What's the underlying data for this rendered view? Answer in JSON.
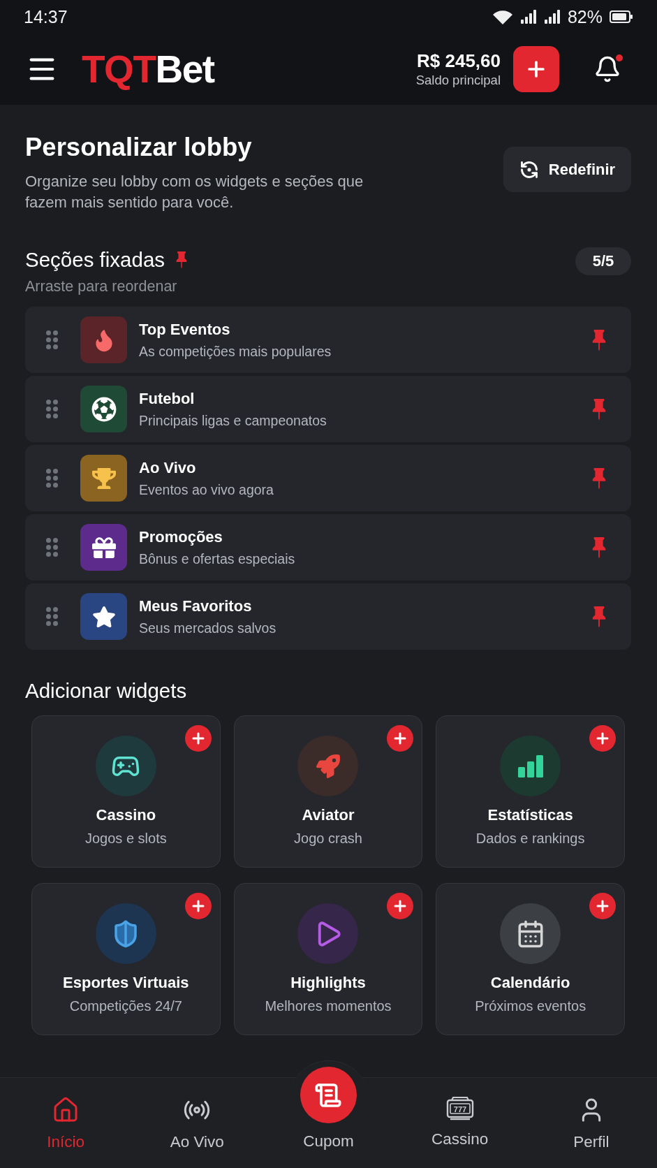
{
  "status_bar": {
    "time": "14:37",
    "battery": "82%"
  },
  "header": {
    "logo": [
      {
        "text": "TQT",
        "accent": true
      },
      {
        "text": "Bet",
        "accent": false
      }
    ],
    "balance": "R$ 245,60",
    "balance_label": "Saldo principal",
    "notifications_unread": true
  },
  "intro": {
    "title": "Personalizar lobby",
    "description": "Organize seu lobby com os widgets e seções que fazem mais sentido para você.",
    "reset_button": "Redefinir"
  },
  "pinned_sections": {
    "title": "Seções fixadas",
    "subtitle": "Arraste para reordenar",
    "count": "5/5",
    "items": [
      {
        "kind": "fire",
        "title": "Top Eventos",
        "subtitle": "As competições mais populares",
        "color": "#5b2429",
        "pinned": true
      },
      {
        "kind": "football",
        "title": "Futebol",
        "subtitle": "Principais ligas e campeonatos",
        "color": "#1f4a35",
        "pinned": true
      },
      {
        "kind": "trophy",
        "title": "Ao Vivo",
        "subtitle": "Eventos ao vivo agora",
        "color": "#8b6421",
        "pinned": true
      },
      {
        "kind": "gift",
        "title": "Promoções",
        "subtitle": "Bônus e ofertas especiais",
        "color": "#5c2b8c",
        "pinned": true
      },
      {
        "kind": "star",
        "title": "Meus Favoritos",
        "subtitle": "Seus mercados salvos",
        "color": "#294682",
        "pinned": true
      }
    ]
  },
  "widgets": {
    "title": "Adicionar widgets",
    "items": [
      {
        "kind": "gamepad",
        "name": "Cassino",
        "subtitle": "Jogos e slots",
        "color": "#1f3a3d"
      },
      {
        "kind": "rocket",
        "name": "Aviator",
        "subtitle": "Jogo crash",
        "color": "#3b2c29"
      },
      {
        "kind": "stats",
        "name": "Estatísticas",
        "subtitle": "Dados e rankings",
        "color": "#1c3a30"
      },
      {
        "kind": "shield",
        "name": "Esportes Virtuais",
        "subtitle": "Competições 24/7",
        "color": "#1d3550"
      },
      {
        "kind": "play",
        "name": "Highlights",
        "subtitle": "Melhores momentos",
        "color": "#35264a"
      },
      {
        "kind": "calendar",
        "name": "Calendário",
        "subtitle": "Próximos eventos",
        "color": "#3c3f44"
      }
    ]
  },
  "bottom_nav": [
    {
      "kind": "home",
      "label": "Início",
      "selected": true
    },
    {
      "kind": "broadcast",
      "label": "Ao Vivo",
      "selected": false
    },
    {
      "kind": "coupon",
      "label": "Cupom",
      "selected": false
    },
    {
      "kind": "slot-machine",
      "label": "Cassino",
      "selected": false,
      "icon_text": "777"
    },
    {
      "kind": "user",
      "label": "Perfil",
      "selected": false
    }
  ]
}
